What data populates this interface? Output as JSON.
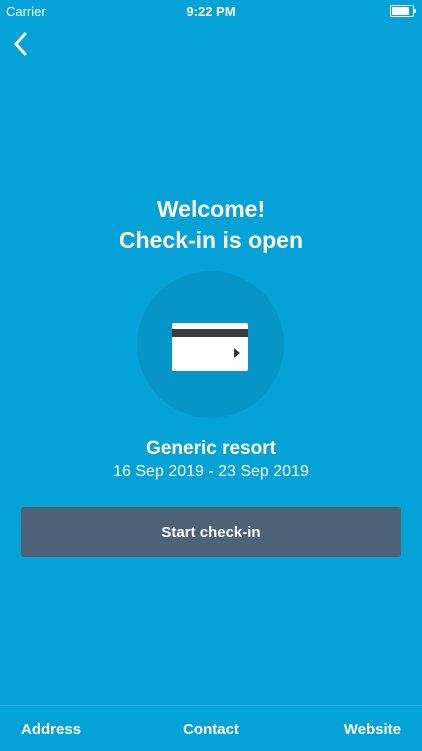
{
  "status_bar": {
    "carrier": "Carrier",
    "time": "9:22 PM"
  },
  "welcome": {
    "line1": "Welcome!",
    "line2": "Check-in is open"
  },
  "card_icon": "credit-card-icon",
  "resort": {
    "name": "Generic resort",
    "dates": "16 Sep 2019 - 23 Sep 2019"
  },
  "start_button_label": "Start check-in",
  "bottom_nav": {
    "address": "Address",
    "contact": "Contact",
    "website": "Website"
  },
  "colors": {
    "background": "#04a2d6",
    "circle": "#0695c9",
    "button": "#4d6276",
    "text": "#ffffff"
  }
}
